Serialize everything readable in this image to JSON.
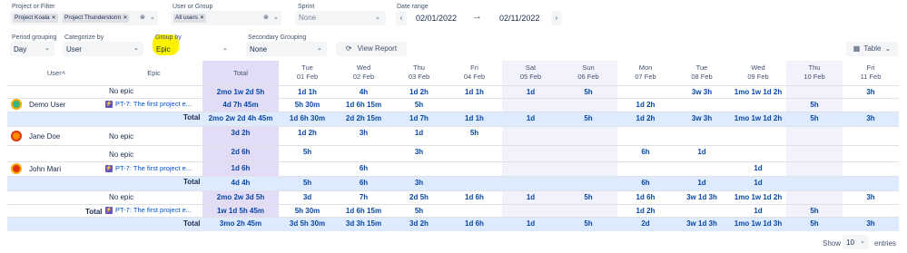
{
  "filters": {
    "project_label": "Project or Filter",
    "projects": [
      "Project Koala",
      "Project Thunderstorm"
    ],
    "user_label": "User or Group",
    "users": [
      "All users"
    ],
    "sprint_label": "Sprint",
    "sprint_placeholder": "None",
    "date_label": "Date range",
    "date_from": "02/01/2022",
    "date_to": "02/11/2022",
    "arrow": "→",
    "prev": "‹",
    "next": "›"
  },
  "options": {
    "period_label": "Period grouping",
    "period_value": "Day",
    "categorize_label": "Categorize by",
    "categorize_value": "User",
    "groupby_label": "Group by",
    "groupby_value": "Epic",
    "secondary_label": "Secondary Grouping",
    "secondary_value": "None",
    "view_report": "View Report",
    "table_btn": "Table"
  },
  "headers": {
    "user": "User",
    "epic": "Epic",
    "total": "Total",
    "days": [
      {
        "d": "Tue",
        "date": "01 Feb"
      },
      {
        "d": "Wed",
        "date": "02 Feb"
      },
      {
        "d": "Thu",
        "date": "03 Feb"
      },
      {
        "d": "Fri",
        "date": "04 Feb"
      },
      {
        "d": "Sat",
        "date": "05 Feb"
      },
      {
        "d": "Sun",
        "date": "06 Feb"
      },
      {
        "d": "Mon",
        "date": "07 Feb"
      },
      {
        "d": "Tue",
        "date": "08 Feb"
      },
      {
        "d": "Wed",
        "date": "09 Feb"
      },
      {
        "d": "Thu",
        "date": "10 Feb"
      },
      {
        "d": "Fri",
        "date": "11 Feb"
      }
    ]
  },
  "labels": {
    "no_epic": "No epic",
    "issue": "PT-7: The first project e...",
    "total": "Total"
  },
  "users": [
    {
      "name": "Demo User",
      "avatar_color": "#36b37e"
    },
    {
      "name": "Jane Doe",
      "avatar_color": "#ff8b00"
    },
    {
      "name": "John Mari",
      "avatar_color": "#de350b"
    }
  ],
  "rows": [
    [
      "2mo 1w 2d 5h",
      "1d 1h",
      "4h",
      "1d 2h",
      "1d 1h",
      "1d",
      "5h",
      "",
      "3w 3h",
      "1mo 1w 1d 2h",
      "",
      "3h"
    ],
    [
      "4d 7h 45m",
      "5h 30m",
      "1d 6h 15m",
      "5h",
      "",
      "",
      "",
      "1d 2h",
      "",
      "",
      "5h",
      ""
    ],
    [
      "2mo 2w 2d 4h 45m",
      "1d 6h 30m",
      "2d 2h 15m",
      "1d 7h",
      "1d 1h",
      "1d",
      "5h",
      "1d 2h",
      "3w 3h",
      "1mo 1w 1d 2h",
      "5h",
      "3h"
    ],
    [
      "3d 2h",
      "1d 2h",
      "3h",
      "1d",
      "5h",
      "",
      "",
      "",
      "",
      "",
      "",
      ""
    ],
    [
      "2d 6h",
      "5h",
      "",
      "3h",
      "",
      "",
      "",
      "6h",
      "1d",
      "",
      "",
      ""
    ],
    [
      "1d 6h",
      "",
      "6h",
      "",
      "",
      "",
      "",
      "",
      "",
      "1d",
      "",
      ""
    ],
    [
      "4d 4h",
      "5h",
      "6h",
      "3h",
      "",
      "",
      "",
      "6h",
      "1d",
      "1d",
      "",
      ""
    ],
    [
      "2mo 2w 3d 5h",
      "3d",
      "7h",
      "2d 5h",
      "1d 6h",
      "1d",
      "5h",
      "1d 6h",
      "3w 1d 3h",
      "1mo 1w 1d 2h",
      "",
      "3h"
    ],
    [
      "1w 1d 5h 45m",
      "5h 30m",
      "1d 6h 15m",
      "5h",
      "",
      "",
      "",
      "1d 2h",
      "",
      "1d",
      "5h",
      ""
    ],
    [
      "3mo 2h 45m",
      "3d 5h 30m",
      "3d 3h 15m",
      "3d 2h",
      "1d 6h",
      "1d",
      "5h",
      "2d",
      "3w 1d 3h",
      "1mo 1w 1d 3h",
      "5h",
      "3h"
    ]
  ],
  "footer": {
    "show": "Show",
    "per_page": "10",
    "entries": "entries"
  },
  "colors": {
    "total_col": "#e3dcf7",
    "weekend": "#f2f2fc",
    "total_row": "#deebff",
    "highlight": "#fff200"
  }
}
